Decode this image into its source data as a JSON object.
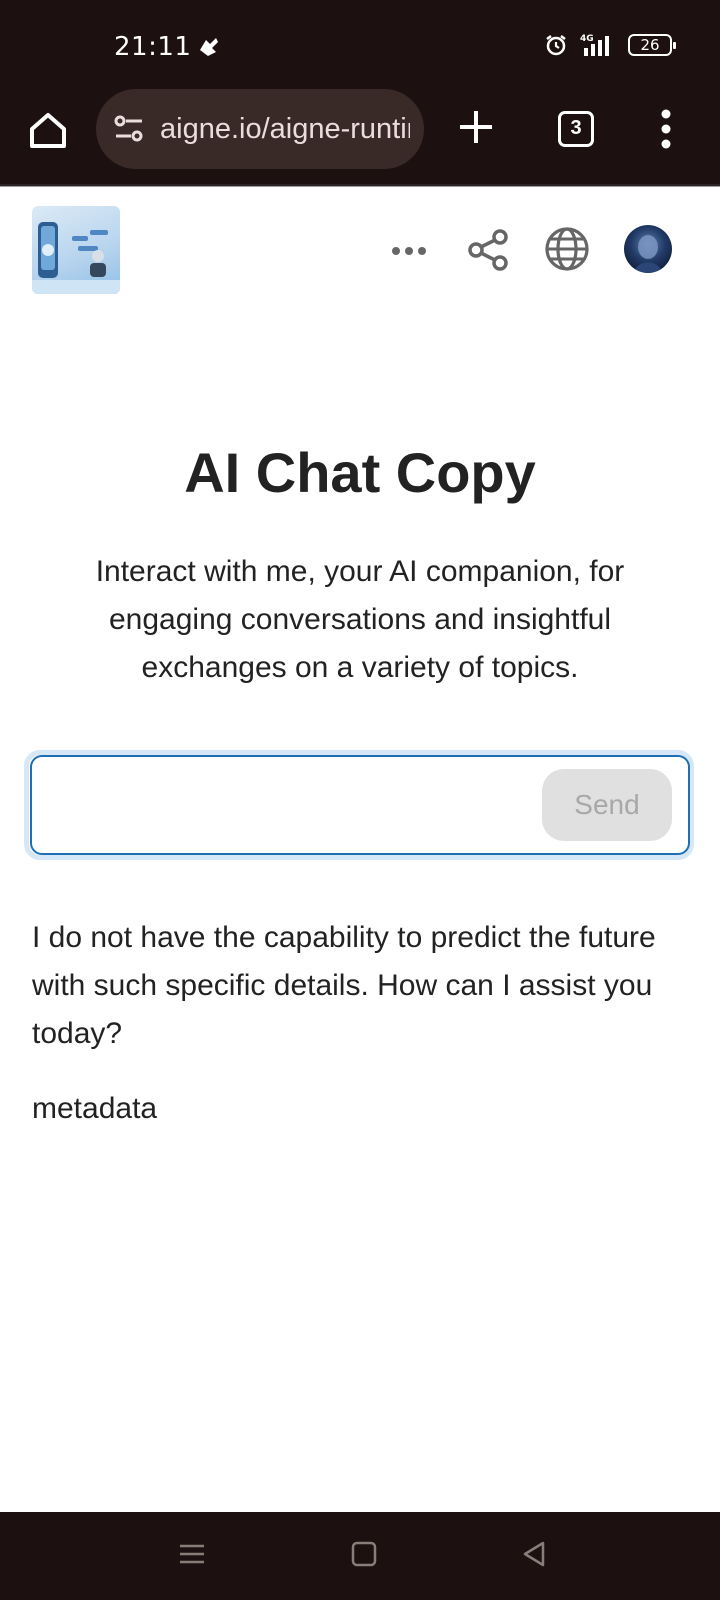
{
  "status_bar": {
    "time": "21:11",
    "network": "4G",
    "battery": "26"
  },
  "browser": {
    "url": "aigne.io/aigne-runtime",
    "tab_count": "3"
  },
  "main": {
    "title": "AI Chat Copy",
    "subtitle": "Interact with me, your AI companion, for engaging conversations and insightful exchanges on a variety of topics.",
    "input_value": "",
    "send_label": "Send",
    "reply": "I do not have the capability to predict the future with such specific details. How can I assist you today?",
    "metadata_label": "metadata"
  },
  "icons": {
    "home": "home-icon",
    "tune": "site-settings-icon",
    "plus": "plus-icon",
    "menu": "more-vert-icon",
    "more": "more-horiz-icon",
    "share": "share-icon",
    "globe": "globe-icon"
  },
  "colors": {
    "chrome": "#1c1110",
    "accent": "#1f6fb5",
    "send_disabled": "#e0e0e0"
  }
}
